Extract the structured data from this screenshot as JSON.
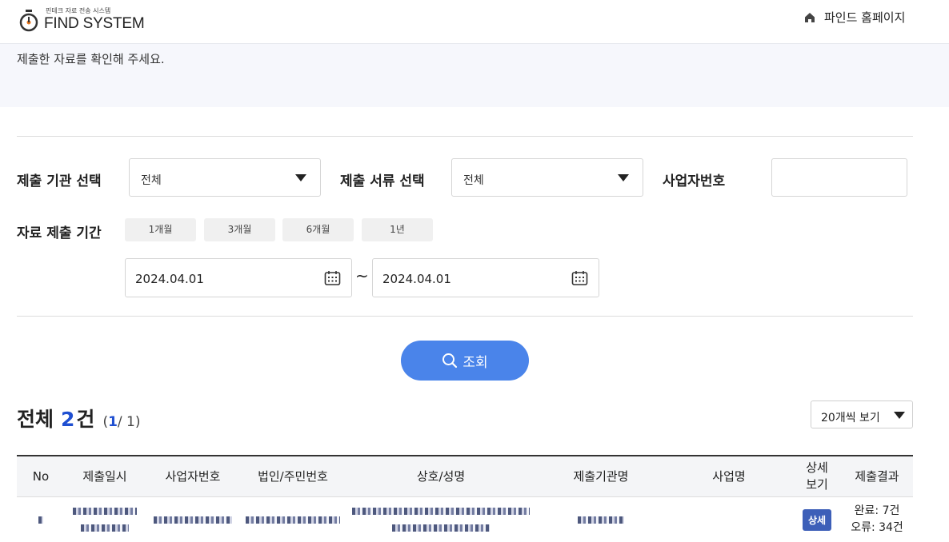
{
  "header": {
    "logo_sub": "핀테크 자료 전송 시스템",
    "logo_main": "FIND SYSTEM",
    "home_link": "파인드 홈페이지"
  },
  "notice": "제출한 자료를 확인해 주세요.",
  "filters": {
    "org_label": "제출 기관 선택",
    "org_value": "전체",
    "doc_label": "제출 서류 선택",
    "doc_value": "전체",
    "bizno_label": "사업자번호",
    "bizno_value": "",
    "period_label": "자료 제출 기간",
    "period_buttons": [
      "1개월",
      "3개월",
      "6개월",
      "1년"
    ],
    "date_from": "2024.04.01",
    "date_tilde": "~",
    "date_to": "2024.04.01"
  },
  "search_button": "조회",
  "summary": {
    "total_label": "전체",
    "total_count": "2",
    "total_unit": "건",
    "page_open": "(",
    "page_current": "1",
    "page_rest": "/ 1)"
  },
  "page_size": "20개씩 보기",
  "table": {
    "columns": [
      "No",
      "제출일시",
      "사업자번호",
      "법인/주민번호",
      "상호/성명",
      "제출기관명",
      "사업명",
      "상세\n보기",
      "제출결과"
    ],
    "rows": [
      {
        "detail_button": "상세",
        "result_ok": "완료: 7건",
        "result_err": "오류: 34건"
      }
    ]
  },
  "colors": {
    "accent": "#4a84ea",
    "count": "#1f4fd1",
    "badge": "#3d5fb8",
    "notice_bg": "#f6f7fc"
  },
  "icons": {
    "logo": "stopwatch-icon",
    "home": "home-icon",
    "calendar": "calendar-icon",
    "search": "search-icon",
    "dropdown": "caret-down-icon"
  }
}
